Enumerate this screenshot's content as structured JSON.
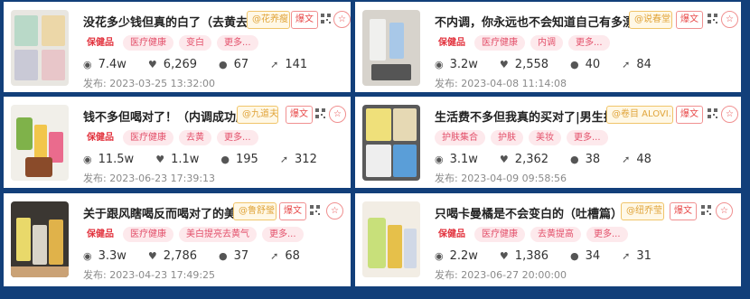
{
  "theme": {
    "background": "#123f7a",
    "hot": "#e84a4a",
    "author": "#e0a43a",
    "tag": "#e3506a"
  },
  "labels": {
    "hot": "爆文",
    "date_prefix": "发布: "
  },
  "cards": [
    {
      "title": "没花多少钱但真的白了（去黄去黑）",
      "author": "@花养瘦",
      "tags": [
        "保健品",
        "医疗健康",
        "变白",
        "更多..."
      ],
      "views": "7.4w",
      "likes": "6,269",
      "comments": "67",
      "shares": "141",
      "date": "2023-03-25 13:32:00"
    },
    {
      "title": "钱不多但喝对了！（内调成功版）",
      "author": "@九道夫",
      "tags": [
        "保健品",
        "医疗健康",
        "去黄",
        "更多..."
      ],
      "views": "11.5w",
      "likes": "1.1w",
      "comments": "195",
      "shares": "312",
      "date": "2023-06-23 17:39:13"
    },
    {
      "title": "关于跟风瞎喝反而喝对了的美白",
      "author": "@鲁舒瑩",
      "tags": [
        "保健品",
        "医疗健康",
        "美白提亮去黄气",
        "更多..."
      ],
      "views": "3.3w",
      "likes": "2,786",
      "comments": "37",
      "shares": "68",
      "date": "2023-04-23 17:49:25"
    },
    {
      "title": "不内调，你永远也不会知道自己有多漂亮!",
      "author": "@说春堂",
      "tags": [
        "保健品",
        "医疗健康",
        "内调",
        "更多..."
      ],
      "views": "3.2w",
      "likes": "2,558",
      "comments": "40",
      "shares": "84",
      "date": "2023-04-08 11:14:08"
    },
    {
      "title": "生活费不多但我真的买对了|男生护肤篇",
      "author": "@卷目 ALOVI...",
      "tags": [
        "护肤集合",
        "护肤",
        "美妆",
        "更多..."
      ],
      "views": "3.1w",
      "likes": "2,362",
      "comments": "38",
      "shares": "48",
      "date": "2023-04-09 09:58:56"
    },
    {
      "title": "只喝卡曼橘是不会变白的（吐槽篇）",
      "author": "@纽乔莹",
      "tags": [
        "保健品",
        "医疗健康",
        "去黄提高",
        "更多..."
      ],
      "views": "2.2w",
      "likes": "1,386",
      "comments": "34",
      "shares": "31",
      "date": "2023-06-27 20:00:00"
    }
  ]
}
